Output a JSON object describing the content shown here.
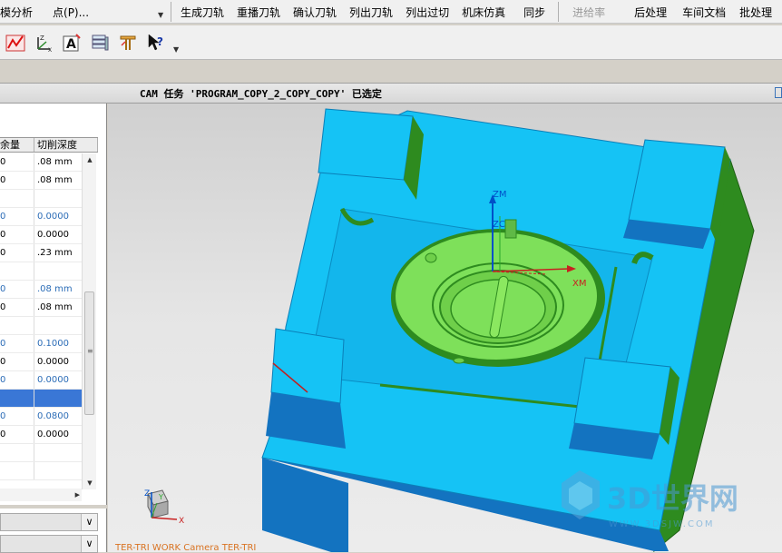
{
  "menubar": {
    "left_items": [
      "模分析",
      "点(P)..."
    ],
    "right_items": [
      "生成刀轨",
      "重播刀轨",
      "确认刀轨",
      "列出刀轨",
      "列出过切",
      "机床仿真",
      "同步"
    ],
    "disabled_items": [
      "进给率"
    ],
    "trailing_items": [
      "后处理",
      "车间文档",
      "批处理"
    ]
  },
  "status": {
    "message": "CAM 任务 'PROGRAM_COPY_2_COPY_COPY' 已选定"
  },
  "grid": {
    "headers": [
      "余量",
      "切削深度"
    ],
    "rows": [
      {
        "a": "0",
        "b": ".08 mm",
        "blue": false
      },
      {
        "a": "0",
        "b": ".08 mm",
        "blue": false
      },
      {
        "a": "",
        "b": "",
        "blue": false
      },
      {
        "a": "0",
        "b": "0.0000",
        "blue": true
      },
      {
        "a": "0",
        "b": "0.0000",
        "blue": false
      },
      {
        "a": "0",
        "b": ".23 mm",
        "blue": false
      },
      {
        "a": "",
        "b": "",
        "blue": false
      },
      {
        "a": "0",
        "b": ".08 mm",
        "blue": true
      },
      {
        "a": "0",
        "b": ".08 mm",
        "blue": false
      },
      {
        "a": "",
        "b": "",
        "blue": false
      },
      {
        "a": "0",
        "b": "0.1000",
        "blue": true
      },
      {
        "a": "0",
        "b": "0.0000",
        "blue": false
      },
      {
        "a": "0",
        "b": "0.0000",
        "blue": true
      },
      {
        "a": "",
        "b": "",
        "blue": false,
        "selected": true
      },
      {
        "a": "0",
        "b": "0.0800",
        "blue": true
      },
      {
        "a": "0",
        "b": "0.0000",
        "blue": false
      },
      {
        "a": "",
        "b": "",
        "blue": false
      },
      {
        "a": "",
        "b": "",
        "blue": false
      }
    ]
  },
  "viewport": {
    "axis_labels": {
      "zm": "ZM",
      "zc": "ZC",
      "xm": "XM"
    },
    "triad_labels": {
      "z": "Z",
      "y": "Y",
      "x": "X"
    },
    "caption": "TER-TRI WORK Camera TER-TRI"
  },
  "watermark": {
    "brand": "3D世界网",
    "url": "WWW.3DSJW.COM"
  },
  "colors": {
    "part_top": "#15c3f5",
    "part_side": "#1373c0",
    "part_wall": "#2e8b1f",
    "dome": "#7ee05a",
    "accent_blue": "#2c6db7",
    "selection": "#3a77d6"
  },
  "icons": [
    "analysis-icon",
    "csys-icon",
    "annotation-icon",
    "layer-icon",
    "tool-icon",
    "whats-this-icon"
  ]
}
